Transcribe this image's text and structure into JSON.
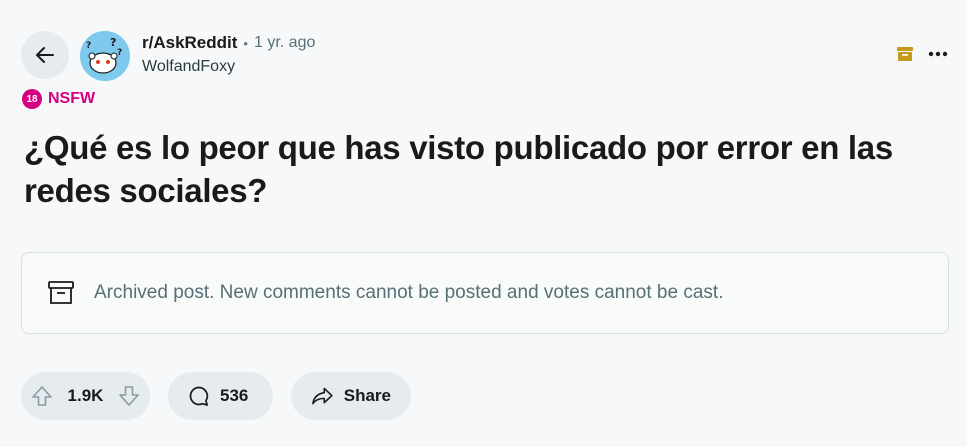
{
  "header": {
    "subreddit": "r/AskReddit",
    "separator": "•",
    "time_ago": "1 yr. ago",
    "author": "WolfandFoxy"
  },
  "badge": {
    "number": "18",
    "label": "NSFW"
  },
  "post": {
    "title": "¿Qué es lo peor que has visto publicado por error en las redes sociales?"
  },
  "notice": {
    "text": "Archived post. New comments cannot be posted and votes cannot be cast."
  },
  "actions": {
    "votes": "1.9K",
    "comments": "536",
    "share_label": "Share"
  },
  "colors": {
    "nsfw": "#d5007f",
    "archive_icon": "#c49a1a",
    "pill_bg": "#e5ebee"
  }
}
